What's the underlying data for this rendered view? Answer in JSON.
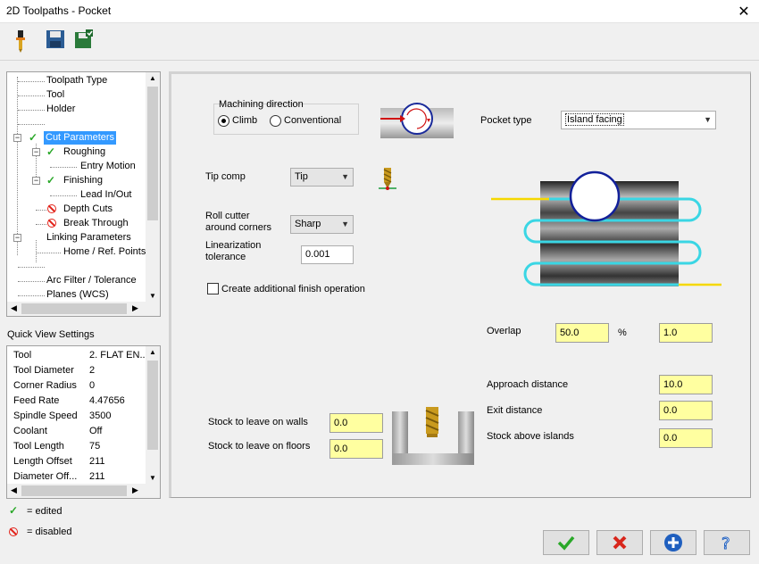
{
  "window": {
    "title": "2D Toolpaths - Pocket",
    "close_glyph": "✕"
  },
  "toolbar": {
    "icons": [
      "tool-pin-icon",
      "save-icon",
      "save-as-icon"
    ]
  },
  "tree": {
    "items": [
      {
        "label": "Toolpath Type"
      },
      {
        "label": "Tool"
      },
      {
        "label": "Holder"
      },
      {
        "label": ""
      },
      {
        "label": "Cut Parameters",
        "status": "edited",
        "selected": true
      },
      {
        "label": "Roughing",
        "status": "edited"
      },
      {
        "label": "Entry Motion"
      },
      {
        "label": "Finishing",
        "status": "edited"
      },
      {
        "label": "Lead In/Out"
      },
      {
        "label": "Depth Cuts",
        "status": "disabled"
      },
      {
        "label": "Break Through",
        "status": "disabled"
      },
      {
        "label": "Linking Parameters"
      },
      {
        "label": "Home / Ref. Points"
      },
      {
        "label": ""
      },
      {
        "label": "Arc Filter / Tolerance"
      },
      {
        "label": "Planes (WCS)"
      }
    ]
  },
  "quick_view": {
    "title": "Quick View Settings",
    "rows": [
      {
        "key": "Tool",
        "value": "2. FLAT EN.."
      },
      {
        "key": "Tool Diameter",
        "value": "2"
      },
      {
        "key": "Corner Radius",
        "value": "0"
      },
      {
        "key": "Feed Rate",
        "value": "4.47656"
      },
      {
        "key": "Spindle Speed",
        "value": "3500"
      },
      {
        "key": "Coolant",
        "value": "Off"
      },
      {
        "key": "Tool Length",
        "value": "75"
      },
      {
        "key": "Length Offset",
        "value": "211"
      },
      {
        "key": "Diameter Off...",
        "value": "211"
      }
    ]
  },
  "legend": {
    "edited": "= edited",
    "disabled": "= disabled"
  },
  "main": {
    "machining_direction": {
      "title": "Machining direction",
      "climb": "Climb",
      "conventional": "Conventional",
      "selected": "Climb"
    },
    "pocket_type": {
      "label": "Pocket type",
      "value": "Island facing"
    },
    "tip_comp": {
      "label": "Tip comp",
      "value": "Tip"
    },
    "roll_cutter": {
      "label_line1": "Roll cutter",
      "label_line2": "around corners",
      "value": "Sharp"
    },
    "linearization": {
      "label_line1": "Linearization",
      "label_line2": "tolerance",
      "value": "0.001"
    },
    "additional_finish": {
      "label": "Create additional finish operation",
      "checked": false
    },
    "overlap": {
      "label": "Overlap",
      "value": "50.0",
      "unit": "%",
      "value2": "1.0"
    },
    "approach_distance": {
      "label": "Approach distance",
      "value": "10.0"
    },
    "exit_distance": {
      "label": "Exit distance",
      "value": "0.0"
    },
    "stock_above_islands": {
      "label": "Stock above islands",
      "value": "0.0"
    },
    "stock_walls": {
      "label": "Stock to leave on walls",
      "value": "0.0"
    },
    "stock_floors": {
      "label": "Stock to leave on floors",
      "value": "0.0"
    }
  },
  "buttons": {
    "ok": {
      "icon": "checkmark-icon",
      "color": "#2aa829"
    },
    "cancel": {
      "icon": "x-icon",
      "color": "#d8261c"
    },
    "help_plus": {
      "icon": "plus-circle-icon",
      "color": "#1f5fbf"
    },
    "help": {
      "icon": "question-icon"
    }
  }
}
